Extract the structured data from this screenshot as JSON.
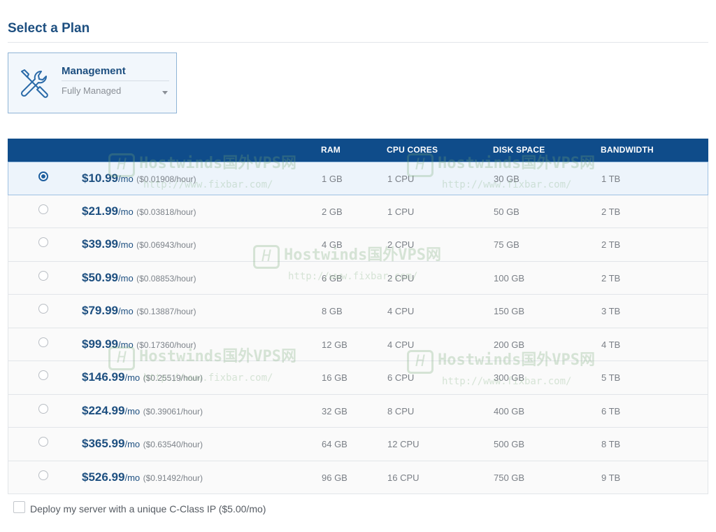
{
  "page": {
    "title": "Select a Plan"
  },
  "management": {
    "label": "Management",
    "selected": "Fully Managed",
    "icon": "tools-icon"
  },
  "table": {
    "headers": {
      "price": "",
      "ram": "RAM",
      "cpu": "CPU CORES",
      "disk": "DISK SPACE",
      "bandwidth": "BANDWIDTH"
    },
    "selected_index": 0,
    "rows": [
      {
        "price": "$10.99",
        "per": "/mo",
        "hourly": "($0.01908/hour)",
        "ram": "1 GB",
        "cpu": "1 CPU",
        "disk": "30 GB",
        "bandwidth": "1 TB"
      },
      {
        "price": "$21.99",
        "per": "/mo",
        "hourly": "($0.03818/hour)",
        "ram": "2 GB",
        "cpu": "1 CPU",
        "disk": "50 GB",
        "bandwidth": "2 TB"
      },
      {
        "price": "$39.99",
        "per": "/mo",
        "hourly": "($0.06943/hour)",
        "ram": "4 GB",
        "cpu": "2 CPU",
        "disk": "75 GB",
        "bandwidth": "2 TB"
      },
      {
        "price": "$50.99",
        "per": "/mo",
        "hourly": "($0.08853/hour)",
        "ram": "6 GB",
        "cpu": "2 CPU",
        "disk": "100 GB",
        "bandwidth": "2 TB"
      },
      {
        "price": "$79.99",
        "per": "/mo",
        "hourly": "($0.13887/hour)",
        "ram": "8 GB",
        "cpu": "4 CPU",
        "disk": "150 GB",
        "bandwidth": "3 TB"
      },
      {
        "price": "$99.99",
        "per": "/mo",
        "hourly": "($0.17360/hour)",
        "ram": "12 GB",
        "cpu": "4 CPU",
        "disk": "200 GB",
        "bandwidth": "4 TB"
      },
      {
        "price": "$146.99",
        "per": "/mo",
        "hourly": "($0.25519/hour)",
        "ram": "16 GB",
        "cpu": "6 CPU",
        "disk": "300 GB",
        "bandwidth": "5 TB"
      },
      {
        "price": "$224.99",
        "per": "/mo",
        "hourly": "($0.39061/hour)",
        "ram": "32 GB",
        "cpu": "8 CPU",
        "disk": "400 GB",
        "bandwidth": "6 TB"
      },
      {
        "price": "$365.99",
        "per": "/mo",
        "hourly": "($0.63540/hour)",
        "ram": "64 GB",
        "cpu": "12 CPU",
        "disk": "500 GB",
        "bandwidth": "8 TB"
      },
      {
        "price": "$526.99",
        "per": "/mo",
        "hourly": "($0.91492/hour)",
        "ram": "96 GB",
        "cpu": "16 CPU",
        "disk": "750 GB",
        "bandwidth": "9 TB"
      }
    ]
  },
  "cclass": {
    "label": "Deploy my server with a unique C-Class IP ($5.00/mo)",
    "checked": false
  },
  "watermark": {
    "name": "Hostwinds国外VPS网",
    "url": "http://www.fixbar.com/",
    "logo": "H"
  },
  "colors": {
    "brand": "#1d4f80",
    "header_bg": "#0f4c8a",
    "selected_bg": "#edf4fb"
  }
}
